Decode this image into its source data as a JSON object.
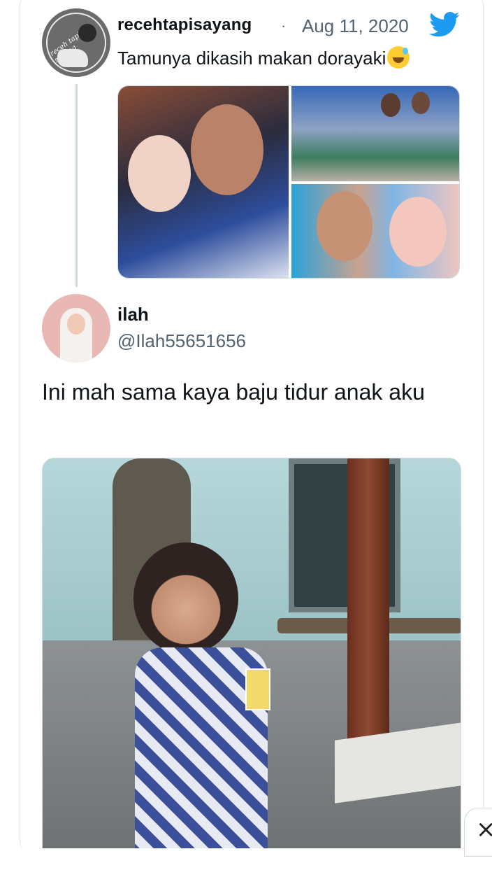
{
  "tweet_quoted": {
    "username": "recehtapisayang",
    "separator": "·",
    "date": "Aug 11, 2020",
    "text": "Tamunya dikasih makan dorayaki",
    "avatar_text": "receh tapi sayang",
    "images": [
      "photo-couple-doraemon-shirts",
      "photo-guests-seated",
      "photo-couple-closeup"
    ]
  },
  "tweet_reply": {
    "display_name": "ilah",
    "handle": "@Ilah55651656",
    "text": "Ini mah sama kaya baju tidur anak aku",
    "image": "photo-child-doraemon-pajamas"
  },
  "close_icon": "×",
  "colors": {
    "twitter_blue": "#1d9bf0",
    "text_primary": "#0f1419",
    "text_secondary": "#536471",
    "border": "#cfd9de"
  }
}
